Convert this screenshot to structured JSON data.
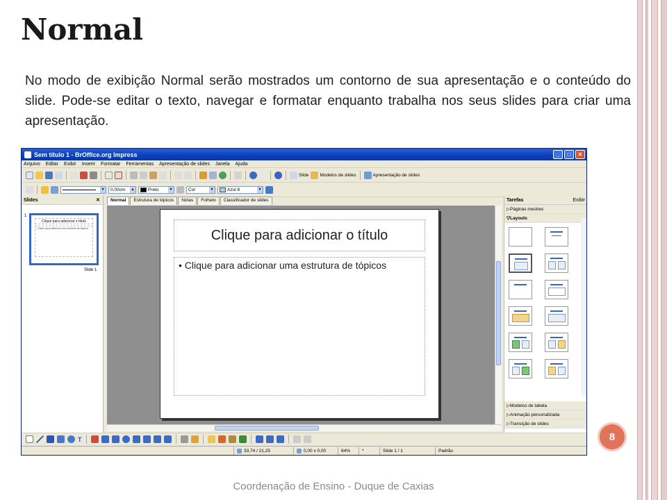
{
  "slide": {
    "title": "Normal",
    "body": "No modo de exibição Normal serão mostrados um contorno de sua apresentação e o conteúdo do slide. Pode-se editar o texto, navegar e formatar enquanto trabalha nos seus slides para criar uma apresentação.",
    "footer": "Coordenação de Ensino - Duque de Caxias",
    "page_number": "8"
  },
  "app": {
    "window_title": "Sem título 1 - BrOffice.org Impress",
    "menu": [
      "Arquivo",
      "Editar",
      "Exibir",
      "Inserir",
      "Formatar",
      "Ferramentas",
      "Apresentação de slides",
      "Janela",
      "Ajuda"
    ],
    "toolbar": {
      "slide_label": "Slide",
      "templates_label": "Modelos de slides",
      "presentation_label": "Apresentação de slides"
    },
    "format_bar": {
      "line_width": "0,00cm",
      "line_color": "Preto",
      "fill_type": "Cor",
      "fill_color": "Azul 8"
    },
    "slides_pane": {
      "header": "Slides",
      "thumb_title": "Clique para adicionar o título",
      "thumb_body": "• Clique para adicionar uma estrutura de tópicos",
      "thumb_number": "1",
      "thumb_label": "Slide 1"
    },
    "tabs": [
      "Normal",
      "Estrutura de tópicos",
      "Notas",
      "Folheto",
      "Classificador de slides"
    ],
    "editor": {
      "title_placeholder": "Clique para adicionar o título",
      "outline_placeholder": "• Clique para adicionar uma estrutura de tópicos"
    },
    "tasks_pane": {
      "header": "Tarefas",
      "view_menu": "Exibir",
      "master_pages": "Páginas mestres",
      "layouts": "Layouts",
      "table_design": "Modelos de tabela",
      "custom_animation": "Animação personalizada",
      "slide_transition": "Transição de slides"
    },
    "status": {
      "position": "33,74 / 21,25",
      "size": "0,00 x 0,00",
      "zoom": "64%",
      "modified": "*",
      "slide": "Slide 1 / 1",
      "master": "Padrão"
    }
  },
  "colors": {
    "accent": "#e0735a",
    "titlebar": "#0c3fb8",
    "selection": "#316ac5"
  }
}
